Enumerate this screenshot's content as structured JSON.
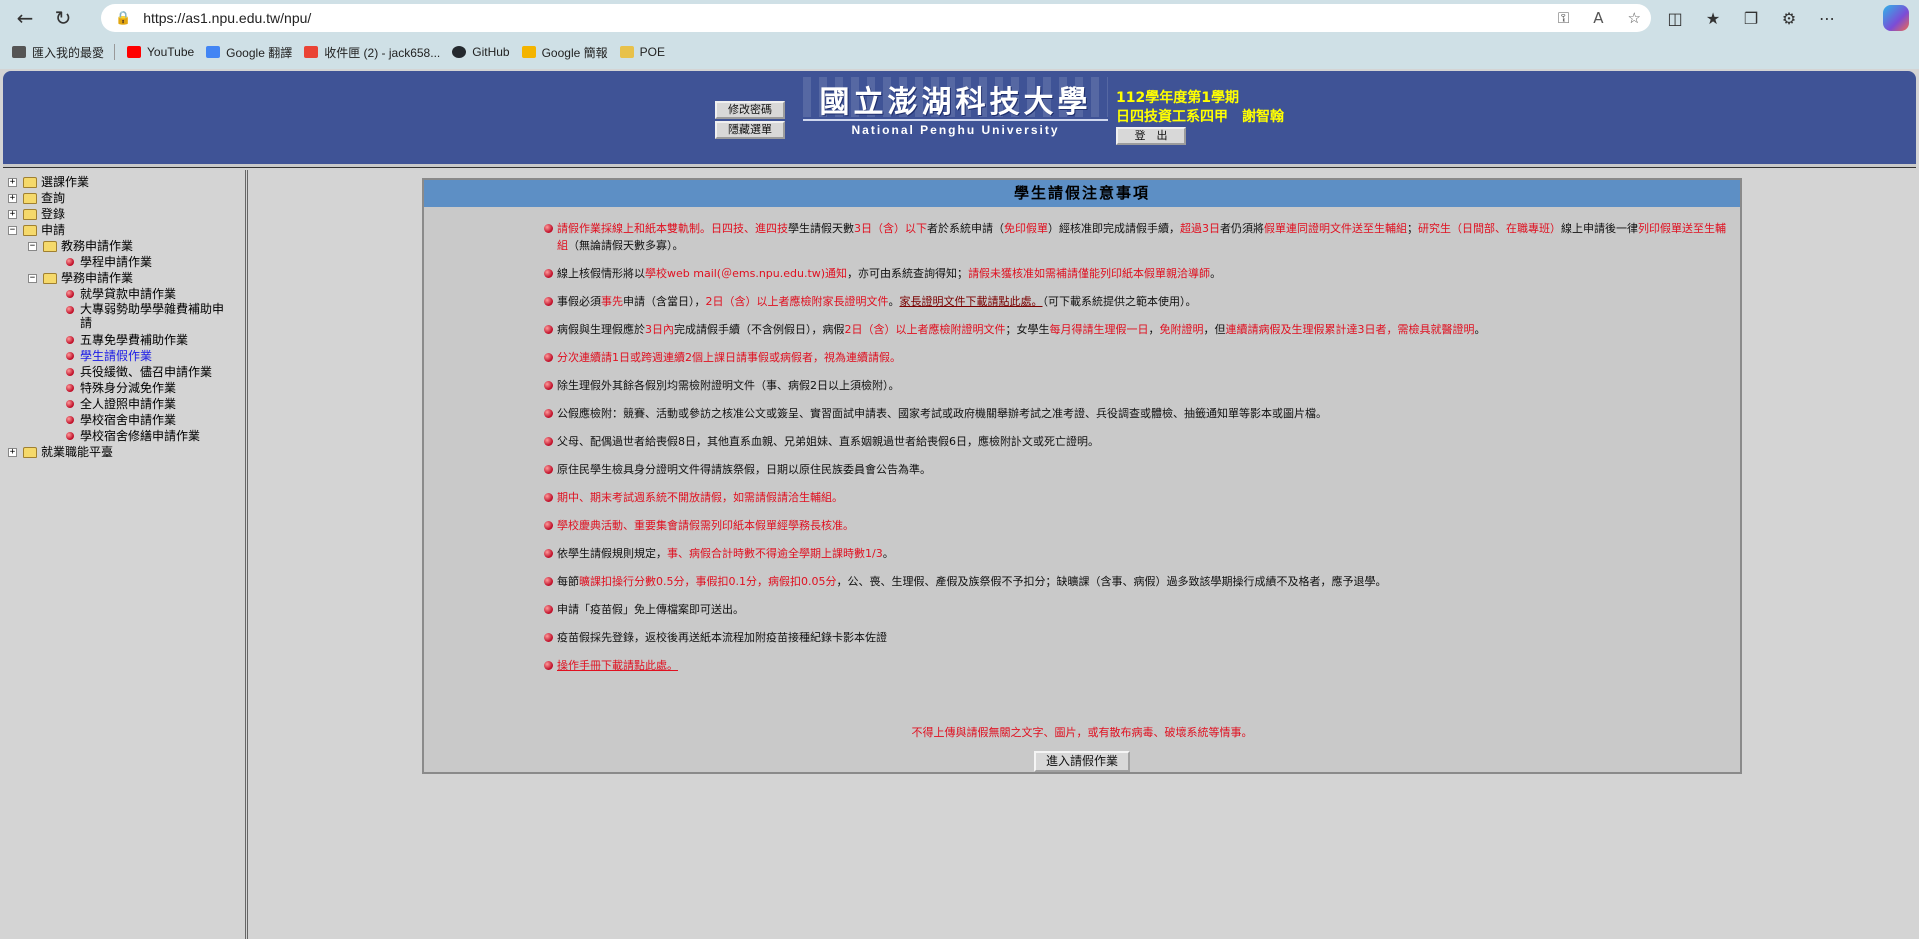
{
  "browser": {
    "url": "https://as1.npu.edu.tw/npu/",
    "bookmarks": [
      {
        "label": "匯入我的最愛",
        "color": "#555555"
      },
      {
        "label": "YouTube",
        "color": "#ff0000"
      },
      {
        "label": "Google 翻譯",
        "color": "#4285f4"
      },
      {
        "label": "收件匣 (2) - jack658...",
        "color": "#ea4335"
      },
      {
        "label": "GitHub",
        "color": "#24292e"
      },
      {
        "label": "Google 簡報",
        "color": "#f4b400"
      },
      {
        "label": "POE",
        "color": "#e8c14a"
      }
    ]
  },
  "header": {
    "change_password": "修改密碼",
    "hide_menu": "隱藏選單",
    "logout": "登　出",
    "logo_cn": "國立澎湖科技大學",
    "logo_en": "National Penghu University",
    "semester": "112學年度第1學期",
    "class_name": "日四技資工系四甲",
    "student_name": "謝智翰"
  },
  "sidebar": {
    "nodes": [
      {
        "label": "選課作業"
      },
      {
        "label": "查詢"
      },
      {
        "label": "登錄"
      },
      {
        "label": "申請"
      },
      {
        "label": "教務申請作業"
      },
      {
        "label": "學程申請作業"
      },
      {
        "label": "學務申請作業"
      },
      {
        "label": "就學貸款申請作業"
      },
      {
        "label": "大專弱勢助學學雜費補助申請"
      },
      {
        "label": "五專免學費補助作業"
      },
      {
        "label": "學生請假作業"
      },
      {
        "label": "兵役緩徵、儘召申請作業"
      },
      {
        "label": "特殊身分減免作業"
      },
      {
        "label": "全人證照申請作業"
      },
      {
        "label": "學校宿舍申請作業"
      },
      {
        "label": "學校宿舍修繕申請作業"
      },
      {
        "label": "就業職能平臺"
      }
    ]
  },
  "notice": {
    "title": "學生請假注意事項",
    "item1": [
      "請假作業採線上和紙本雙軌制。",
      "日四技、進四技",
      "學生請假天數",
      "3日（含）以下",
      "者於系統申請（",
      "免印假單",
      "）經核准即完成請假手續，",
      "超過3日",
      "者仍須將",
      "假單連同證明文件送至生輔組",
      "；",
      "研究生（日間部、在職專班）",
      "線上申請後一律",
      "列印假單送至生輔組",
      "（無論請假天數多寡）。"
    ],
    "item2": [
      "線上核假情形將以",
      "學校web mail(＠ems.npu.edu.tw)通知",
      "，亦可由系統查詢得知；",
      "請假未獲核准如需補請僅能列印紙本假單親洽導師",
      "。"
    ],
    "item3": [
      "事假必須",
      "事先",
      "申請（含當日），",
      "2日（含）以上者應檢附家長證明文件",
      "。",
      "家長證明文件下載請點此處。",
      "（可下載系統提供之範本使用）。"
    ],
    "item4": [
      "病假與生理假應於",
      "3日內",
      "完成請假手續（不含例假日），病假",
      "2日（含）以上者應檢附證明文件",
      "；女學生",
      "每月得請生理假一日",
      "，",
      "免附證明",
      "，但",
      "連續請病假及生理假累計達3日者，需檢具就醫證明",
      "。"
    ],
    "item5": "分次連續請1日或跨週連續2個上課日請事假或病假者，視為連續請假。",
    "item6": "除生理假外其餘各假別均需檢附證明文件（事、病假2日以上須檢附）。",
    "item7": "公假應檢附：競賽、活動或參訪之核准公文或簽呈、實習面試申請表、國家考試或政府機關舉辦考試之准考證、兵役調查或體檢、抽籤通知單等影本或圖片檔。",
    "item8": "父母、配偶過世者給喪假8日，其他直系血親、兄弟姐妹、直系姻親過世者給喪假6日，應檢附訃文或死亡證明。",
    "item9": "原住民學生檢具身分證明文件得請族祭假，日期以原住民族委員會公告為準。",
    "item10": "期中、期末考試週系統不開放請假，如需請假請洽生輔組。",
    "item11": "學校慶典活動、重要集會請假需列印紙本假單經學務長核准。",
    "item12": [
      "依學生請假規則規定，",
      "事、病假合計時數不得逾全學期上課時數1/3",
      "。"
    ],
    "item13": [
      "每節",
      "曠課扣操行分數0.5分，事假扣0.1分，病假扣0.05分",
      "，公、喪、生理假、產假及族祭假不予扣分；缺曠課（含事、病假）過多致該學期操行成績不及格者，應予退學。"
    ],
    "item14": "申請「疫苗假」免上傳檔案即可送出。",
    "item15": "疫苗假採先登錄，返校後再送紙本流程加附疫苗接種紀錄卡影本佐證",
    "item16": "操作手冊下載請點此處。",
    "footer_warning": "不得上傳與請假無關之文字、圖片，或有散布病毒、破壞系統等情事。",
    "enter_button": "進入請假作業"
  }
}
